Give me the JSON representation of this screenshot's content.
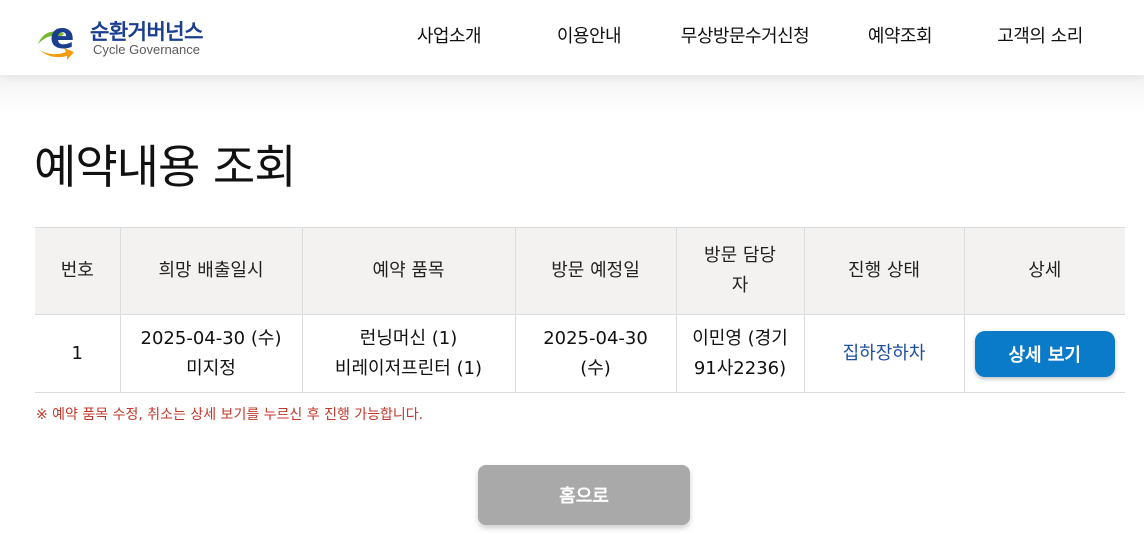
{
  "brand": {
    "name_ko": "순환거버넌스",
    "name_en": "Cycle Governance",
    "colors": {
      "e_letter": "#1a3f8f",
      "arrow_green": "#7cb82f",
      "arrow_orange": "#f39c12",
      "text_blue": "#1a3f8f"
    }
  },
  "nav": {
    "items": [
      {
        "label": "사업소개"
      },
      {
        "label": "이용안내"
      },
      {
        "label": "무상방문수거신청"
      },
      {
        "label": "예약조회"
      },
      {
        "label": "고객의 소리"
      }
    ]
  },
  "page": {
    "title": "예약내용 조회"
  },
  "table": {
    "headers": {
      "no": "번호",
      "desired_date": "희망 배출일시",
      "items": "예약 품목",
      "visit_date": "방문 예정일",
      "manager_line1": "방문 담당",
      "manager_line2": "자",
      "status": "진행 상태",
      "detail": "상세"
    },
    "rows": [
      {
        "no": "1",
        "desired_date_line1": "2025-04-30 (수)",
        "desired_date_line2": "미지정",
        "item1": "런닝머신 (1)",
        "item2": "비레이저프린터 (1)",
        "visit_date_line1": "2025-04-30",
        "visit_date_line2": "(수)",
        "manager_line1": "이민영 (경기",
        "manager_line2": "91사2236)",
        "status": "집하장하차",
        "detail_button": "상세 보기"
      }
    ]
  },
  "notice": "※ 예약 품목 수정, 취소는 상세 보기를 누르신 후 진행 가능합니다.",
  "home_button": "홈으로",
  "colors": {
    "primary_button": "#0a7bc8",
    "status_text": "#1f4fa0",
    "notice_text": "#c0392b",
    "home_button": "#a9a9a9",
    "table_header_bg": "#f3f2f1"
  }
}
